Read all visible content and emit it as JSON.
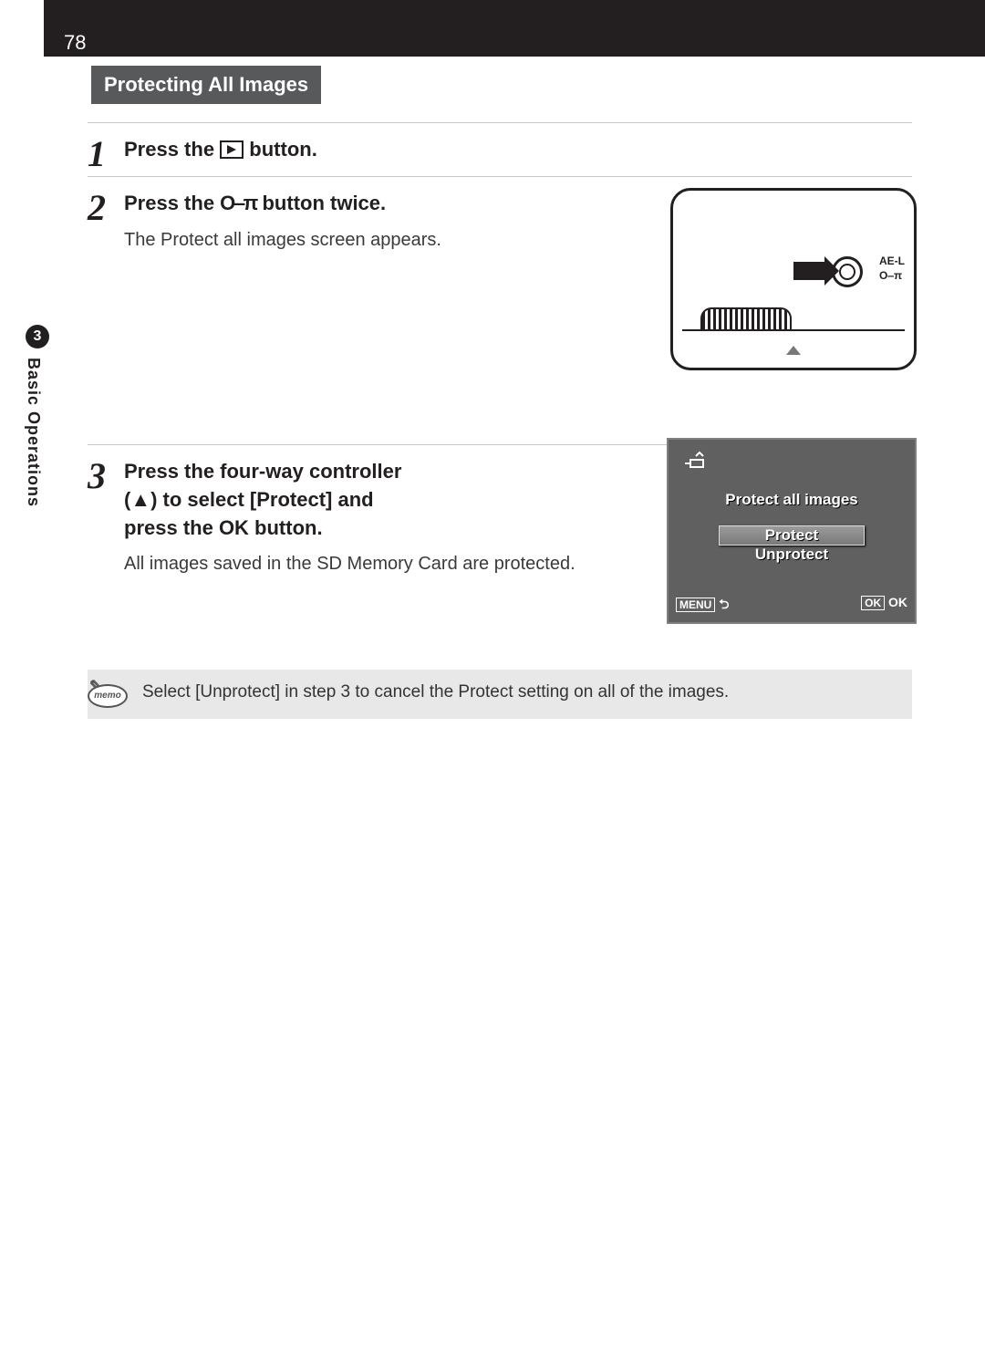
{
  "page_number": "78",
  "heading": "Protecting All Images",
  "sidebar": {
    "chapter_number": "3",
    "chapter_label": "Basic Operations"
  },
  "steps": [
    {
      "num": "1",
      "title_pre": "Press the ",
      "title_post": " button."
    },
    {
      "num": "2",
      "title_pre": "Press the ",
      "title_mid": "O‒π",
      "title_post": " button twice.",
      "desc": "The Protect all images screen appears."
    },
    {
      "num": "3",
      "title_line1": "Press the four-way controller",
      "title_line2": "(▲) to select [Protect] and",
      "title_line3_pre": "press the ",
      "title_line3_mid": "OK",
      "title_line3_post": " button.",
      "desc": "All images saved in the SD Memory Card are protected."
    }
  ],
  "camera_labels": {
    "l1": "AE-L",
    "l2": "O‒π"
  },
  "lcd": {
    "title": "Protect all images",
    "option1": "Protect",
    "option2": "Unprotect",
    "menu": "MENU",
    "ok_box": "OK",
    "ok_txt": "OK"
  },
  "memo": {
    "label": "memo",
    "text": "Select [Unprotect] in step 3 to cancel the Protect setting on all of the images."
  }
}
